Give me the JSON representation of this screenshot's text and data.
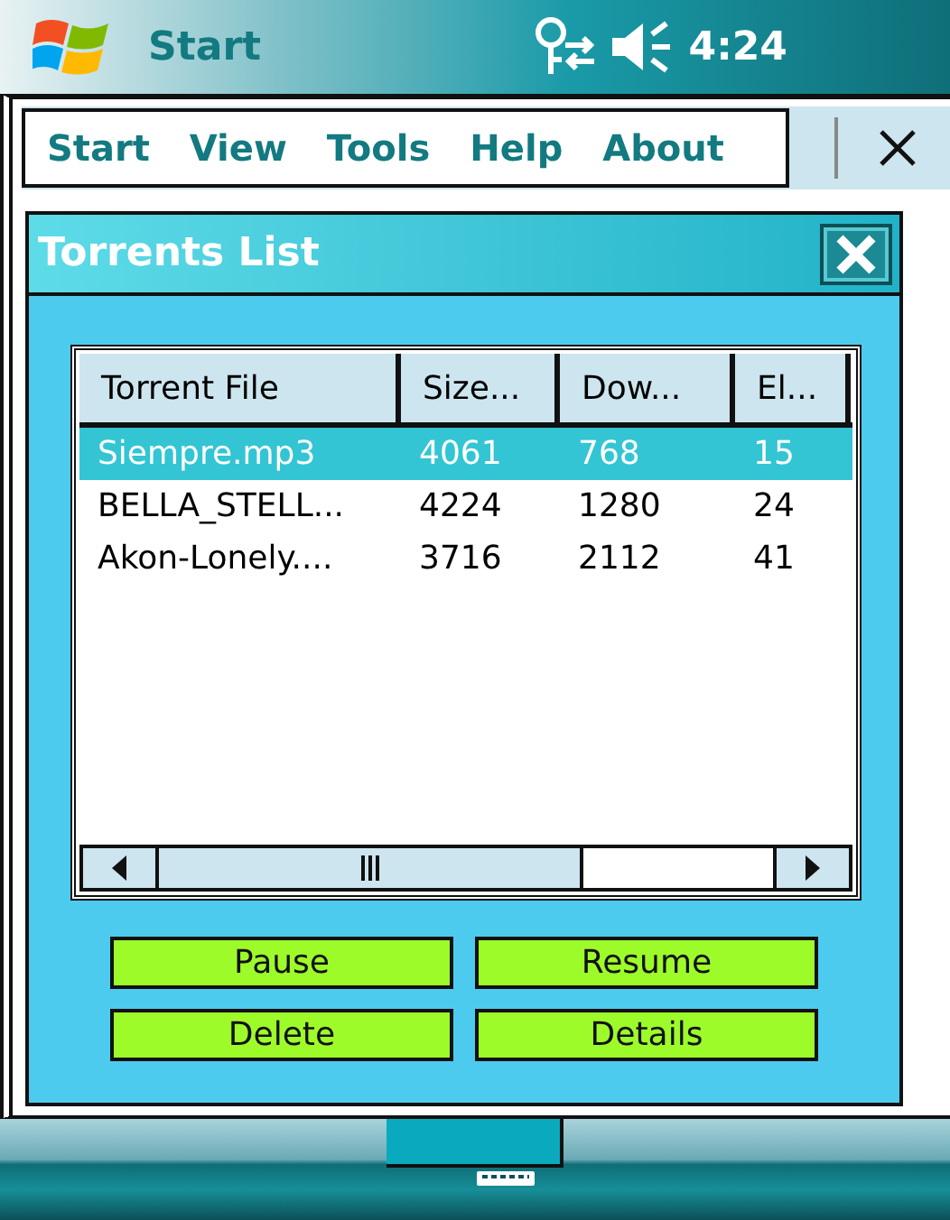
{
  "taskbar": {
    "title": "Start",
    "time": "4:24"
  },
  "menu": [
    "Start",
    "View",
    "Tools",
    "Help",
    "About"
  ],
  "dialog": {
    "title": "Torrents List",
    "table": {
      "columns": [
        "Torrent File",
        "Size...",
        "Dow...",
        "El..."
      ],
      "rows": [
        {
          "cells": [
            "Siempre.mp3",
            "4061",
            "768",
            "15"
          ],
          "selected": true
        },
        {
          "cells": [
            "BELLA_STELL...",
            "4224",
            "1280",
            "24"
          ],
          "selected": false
        },
        {
          "cells": [
            "Akon-Lonely....",
            "3716",
            "2112",
            "41"
          ],
          "selected": false
        }
      ]
    },
    "buttons": [
      "Pause",
      "Resume",
      "Delete",
      "Details"
    ]
  }
}
